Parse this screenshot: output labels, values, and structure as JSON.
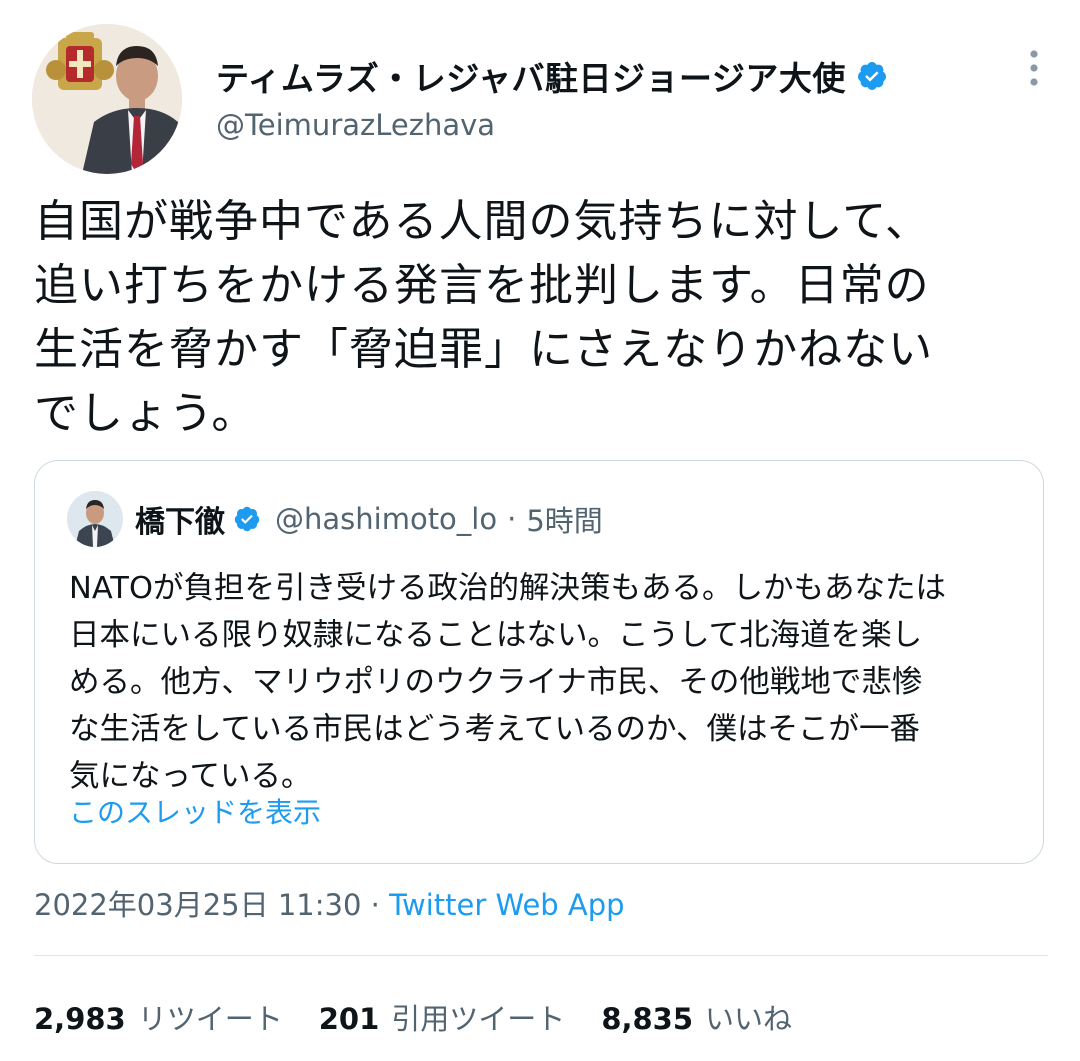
{
  "author": {
    "display_name": "ティムラズ・レジャバ駐日ジョージア大使",
    "handle": "@TeimurazLezhava",
    "verified_icon": "verified-badge-icon"
  },
  "tweet": {
    "text": "自国が戦争中である人間の気持ちに対して、\n追い打ちをかける発言を批判します。日常の\n生活を脅かす「脅迫罪」にさえなりかねない\nでしょう。"
  },
  "quoted_tweet": {
    "name": "橋下徹",
    "handle": "@hashimoto_lo",
    "separator": "·",
    "time": "5時間",
    "text": "NATOが負担を引き受ける政治的解決策もある。しかもあなたは\n日本にいる限り奴隷になることはない。こうして北海道を楽し\nめる。他方、マリウポリのウクライナ市民、その他戦地で悲惨\nな生活をしている市民はどう考えているのか、僕はそこが一番\n気になっている。",
    "show_thread_label": "このスレッドを表示"
  },
  "meta": {
    "timestamp": "2022年03月25日 11:30",
    "separator": " · ",
    "source": "Twitter Web App"
  },
  "stats": {
    "retweets_count": "2,983",
    "retweets_label": "リツイート",
    "quotes_count": "201",
    "quotes_label": "引用ツイート",
    "likes_count": "8,835",
    "likes_label": "いいね"
  },
  "colors": {
    "accent": "#1d9bf0",
    "text_primary": "#0f1419",
    "text_secondary": "#536471",
    "border": "#cfd9de"
  }
}
